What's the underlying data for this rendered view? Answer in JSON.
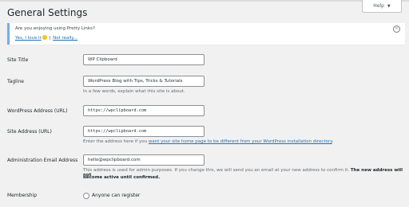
{
  "help_tab": {
    "label": "Help"
  },
  "page": {
    "title": "General Settings"
  },
  "notice": {
    "message": "Are you enjoying using Pretty Links?",
    "link_yes": "Yes, I love it",
    "separator": "|",
    "link_no": "Not really..."
  },
  "fields": {
    "site_title": {
      "label": "Site Title",
      "value": "WP Clipboard"
    },
    "tagline": {
      "label": "Tagline",
      "value": "WordPress Blog with Tips, Tricks & Tutorials",
      "description": "In a few words, explain what this site is about."
    },
    "wp_address": {
      "label": "WordPress Address (URL)",
      "value": "https://wpclipboard.com"
    },
    "site_address": {
      "label": "Site Address (URL)",
      "value": "https://wpclipboard.com",
      "desc_prefix": "Enter the address here if you ",
      "desc_link": "want your site home page to be different from your WordPress installation directory",
      "desc_suffix": "."
    },
    "admin_email": {
      "label": "Administration Email Address",
      "value": "hello@wpclipboard.com",
      "desc_line1_prefix": "This address is used for admin purposes. If you change this, we will send you an email at your new address to confirm it. ",
      "desc_line1_bold": "The new address will not",
      "desc_line2": "become active until confirmed."
    },
    "membership": {
      "label": "Membership",
      "checkbox_label": "Anyone can register"
    }
  }
}
